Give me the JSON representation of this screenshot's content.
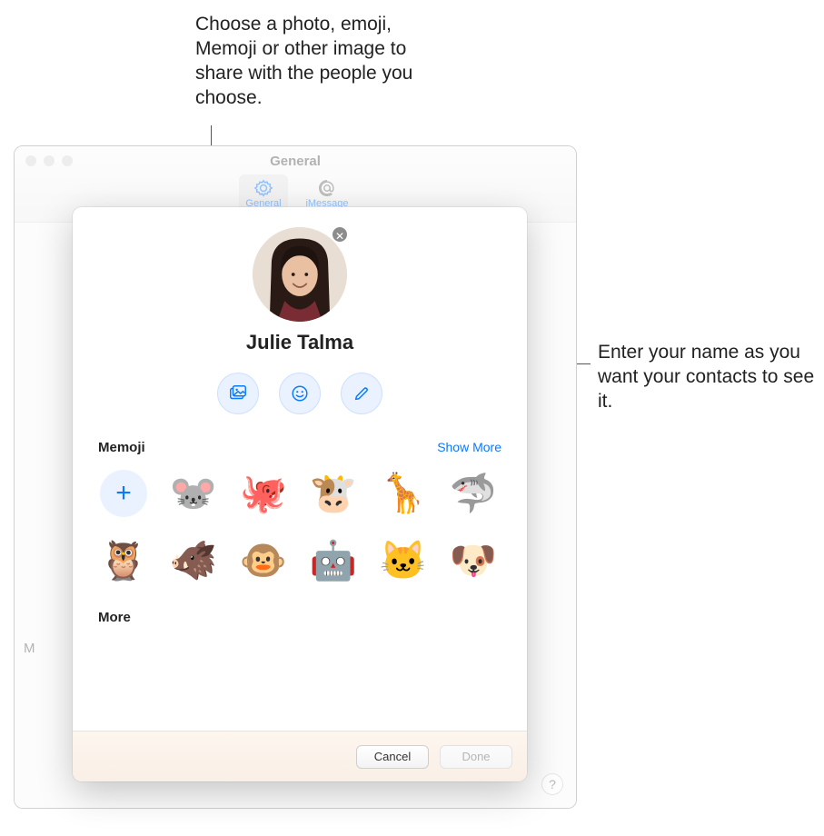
{
  "callouts": {
    "top": "Choose a photo, emoji, Memoji or other image to share with the people you choose.",
    "right": "Enter your name as you want your contacts to see it."
  },
  "pref_window": {
    "title": "General",
    "tabs": {
      "general": "General",
      "imessage": "iMessage"
    },
    "truncated_label": "M",
    "help_label": "?"
  },
  "sheet": {
    "avatar_clear_glyph": "✕",
    "name": "Julie Talma",
    "section_memoji": "Memoji",
    "show_more": "Show More",
    "section_more": "More",
    "add_glyph": "+",
    "memoji": [
      {
        "name": "add",
        "glyph": ""
      },
      {
        "name": "mouse",
        "glyph": "🐭"
      },
      {
        "name": "octopus",
        "glyph": "🐙"
      },
      {
        "name": "cow",
        "glyph": "🐮"
      },
      {
        "name": "giraffe",
        "glyph": "🦒"
      },
      {
        "name": "shark",
        "glyph": "🦈"
      },
      {
        "name": "owl",
        "glyph": "🦉"
      },
      {
        "name": "boar",
        "glyph": "🐗"
      },
      {
        "name": "monkey",
        "glyph": "🐵"
      },
      {
        "name": "robot",
        "glyph": "🤖"
      },
      {
        "name": "cat",
        "glyph": "🐱"
      },
      {
        "name": "dog",
        "glyph": "🐶"
      }
    ],
    "buttons": {
      "cancel": "Cancel",
      "done": "Done"
    }
  }
}
